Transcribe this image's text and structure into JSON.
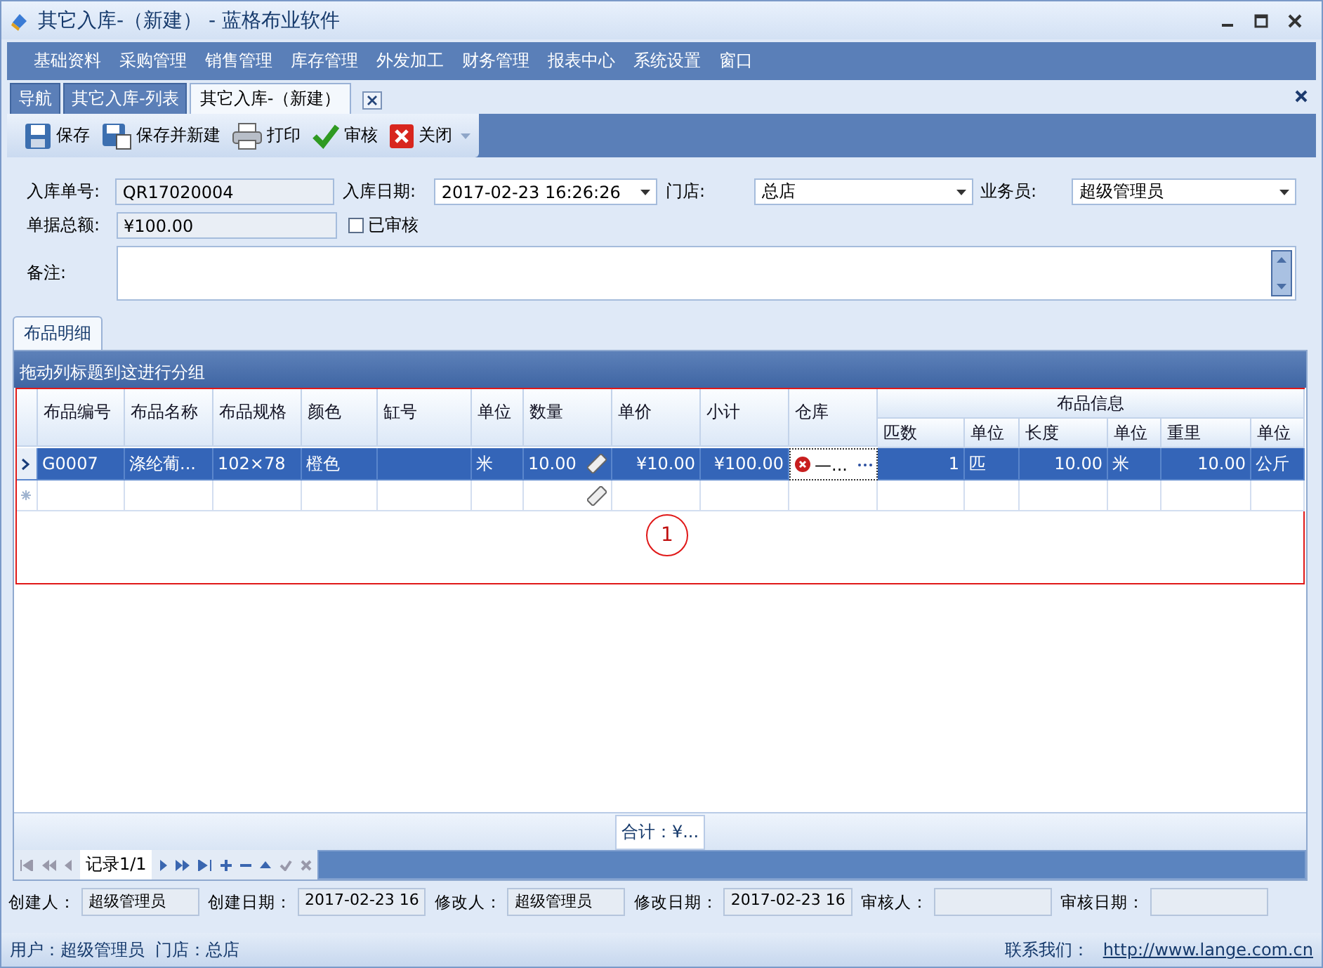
{
  "window": {
    "title": "其它入库-（新建） - 蓝格布业软件"
  },
  "menu": [
    "基础资料",
    "采购管理",
    "销售管理",
    "库存管理",
    "外发加工",
    "财务管理",
    "报表中心",
    "系统设置",
    "窗口"
  ],
  "tabs": [
    {
      "label": "导航",
      "selected": false
    },
    {
      "label": "其它入库-列表",
      "selected": false
    },
    {
      "label": "其它入库-（新建）",
      "selected": true
    }
  ],
  "toolbar": [
    {
      "kind": "save",
      "label": "保存"
    },
    {
      "kind": "save-new",
      "label": "保存并新建"
    },
    {
      "kind": "print",
      "label": "打印"
    },
    {
      "kind": "approve",
      "label": "审核"
    },
    {
      "kind": "close",
      "label": "关闭"
    }
  ],
  "form": {
    "order_no": {
      "label": "入库单号:",
      "value": "QR17020004"
    },
    "date": {
      "label": "入库日期:",
      "value": "2017-02-23 16:26:26"
    },
    "store": {
      "label": "门店:",
      "value": "总店"
    },
    "salesperson": {
      "label": "业务员:",
      "value": "超级管理员"
    },
    "total": {
      "label": "单据总额:",
      "value": "¥100.00"
    },
    "approved": {
      "label": "已审核",
      "checked": false
    },
    "remark": {
      "label": "备注:"
    }
  },
  "detail_tab": {
    "label": "布品明细"
  },
  "grid": {
    "group_hint": "拖动列标题到这进行分组",
    "columns": [
      {
        "label": "布品编号",
        "kind": "text"
      },
      {
        "label": "布品名称",
        "kind": "text"
      },
      {
        "label": "布品规格",
        "kind": "text"
      },
      {
        "label": "颜色",
        "kind": "text"
      },
      {
        "label": "缸号",
        "kind": "text"
      },
      {
        "label": "单位",
        "kind": "text"
      },
      {
        "label": "数量",
        "kind": "quantity"
      },
      {
        "label": "单价",
        "kind": "number"
      },
      {
        "label": "小计",
        "kind": "number"
      },
      {
        "label": "仓库",
        "kind": "lookup"
      }
    ],
    "band": {
      "label": "布品信息",
      "columns": [
        {
          "label": "匹数",
          "kind": "number"
        },
        {
          "label": "单位",
          "kind": "text"
        },
        {
          "label": "长度",
          "kind": "number"
        },
        {
          "label": "单位",
          "kind": "text"
        },
        {
          "label": "重里",
          "kind": "number"
        },
        {
          "label": "单位",
          "kind": "text"
        }
      ]
    },
    "rows": [
      {
        "selected": true,
        "cells": [
          "G0007",
          "涤纶葡...",
          "102×78",
          "橙色",
          "",
          "米",
          "10.00",
          "¥10.00",
          "¥100.00",
          "—...",
          "1",
          "匹",
          "10.00",
          "米",
          "10.00",
          "公斤"
        ]
      }
    ],
    "annotation": "1",
    "summary": "合计：¥...",
    "record": "记录1/1"
  },
  "audit": [
    {
      "label": "创建人：",
      "value": "超级管理员"
    },
    {
      "label": "创建日期：",
      "value": "2017-02-23 16"
    },
    {
      "label": "修改人：",
      "value": "超级管理员"
    },
    {
      "label": "修改日期：",
      "value": "2017-02-23 16"
    },
    {
      "label": "审核人："
    },
    {
      "label": "审核日期："
    }
  ],
  "status_bar": {
    "user": "用户：超级管理员  门店：总店",
    "contact_label": "联系我们：",
    "link": "http://www.lange.com.cn"
  }
}
